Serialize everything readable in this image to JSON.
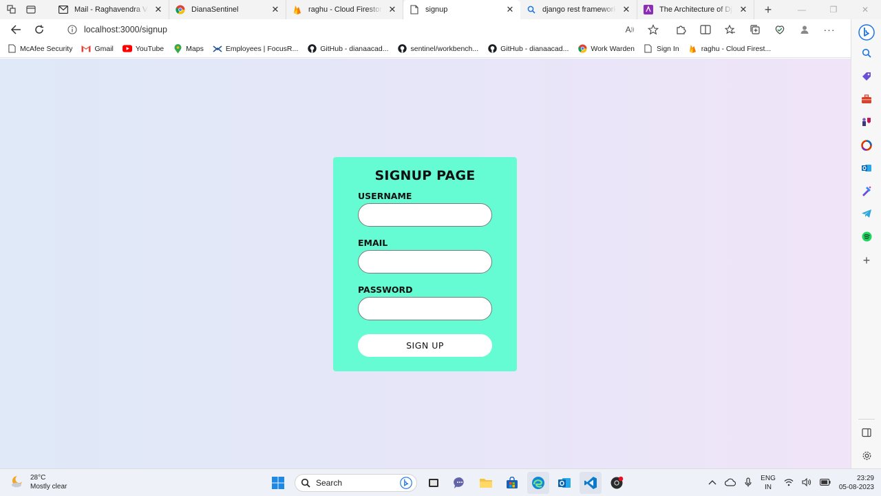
{
  "browser": {
    "tabs": [
      {
        "title": "Mail - Raghavendra Vattikuti",
        "icon": "mail-icon"
      },
      {
        "title": "DianaSentinel",
        "icon": "chrome-icon"
      },
      {
        "title": "raghu - Cloud Firestore - Firebase",
        "icon": "firebase-icon"
      },
      {
        "title": "signup",
        "icon": "page-icon",
        "active": true
      },
      {
        "title": "django rest framework architecture",
        "icon": "search-icon"
      },
      {
        "title": "The Architecture of Django",
        "icon": "site-icon"
      }
    ],
    "address": {
      "url": "localhost:3000/signup"
    },
    "bookmarks": [
      {
        "label": "McAfee Security",
        "icon": "page-icon"
      },
      {
        "label": "Gmail",
        "icon": "gmail-icon"
      },
      {
        "label": "YouTube",
        "icon": "youtube-icon"
      },
      {
        "label": "Maps",
        "icon": "maps-icon"
      },
      {
        "label": "Employees | FocusR...",
        "icon": "focusr-icon"
      },
      {
        "label": "GitHub - dianaacad...",
        "icon": "github-icon"
      },
      {
        "label": "sentinel/workbench...",
        "icon": "github-icon"
      },
      {
        "label": "GitHub - dianaacad...",
        "icon": "github-icon"
      },
      {
        "label": "Work Warden",
        "icon": "chrome-icon"
      },
      {
        "label": "Sign In",
        "icon": "page-icon"
      },
      {
        "label": "raghu - Cloud Firest...",
        "icon": "firebase-icon"
      }
    ]
  },
  "signup": {
    "title": "SIGNUP PAGE",
    "username_label": "USERNAME",
    "username_value": "",
    "email_label": "EMAIL",
    "email_value": "",
    "password_label": "PASSWORD",
    "password_value": "",
    "submit_label": "SIGN UP"
  },
  "taskbar": {
    "weather_temp": "28°C",
    "weather_desc": "Mostly clear",
    "search_placeholder": "Search",
    "lang_line1": "ENG",
    "lang_line2": "IN",
    "time": "23:29",
    "date": "05-08-2023"
  },
  "colors": {
    "card": "#66fcd3",
    "page_gradient_start": "#dfe9f7",
    "page_gradient_end": "#f0e4f8"
  }
}
